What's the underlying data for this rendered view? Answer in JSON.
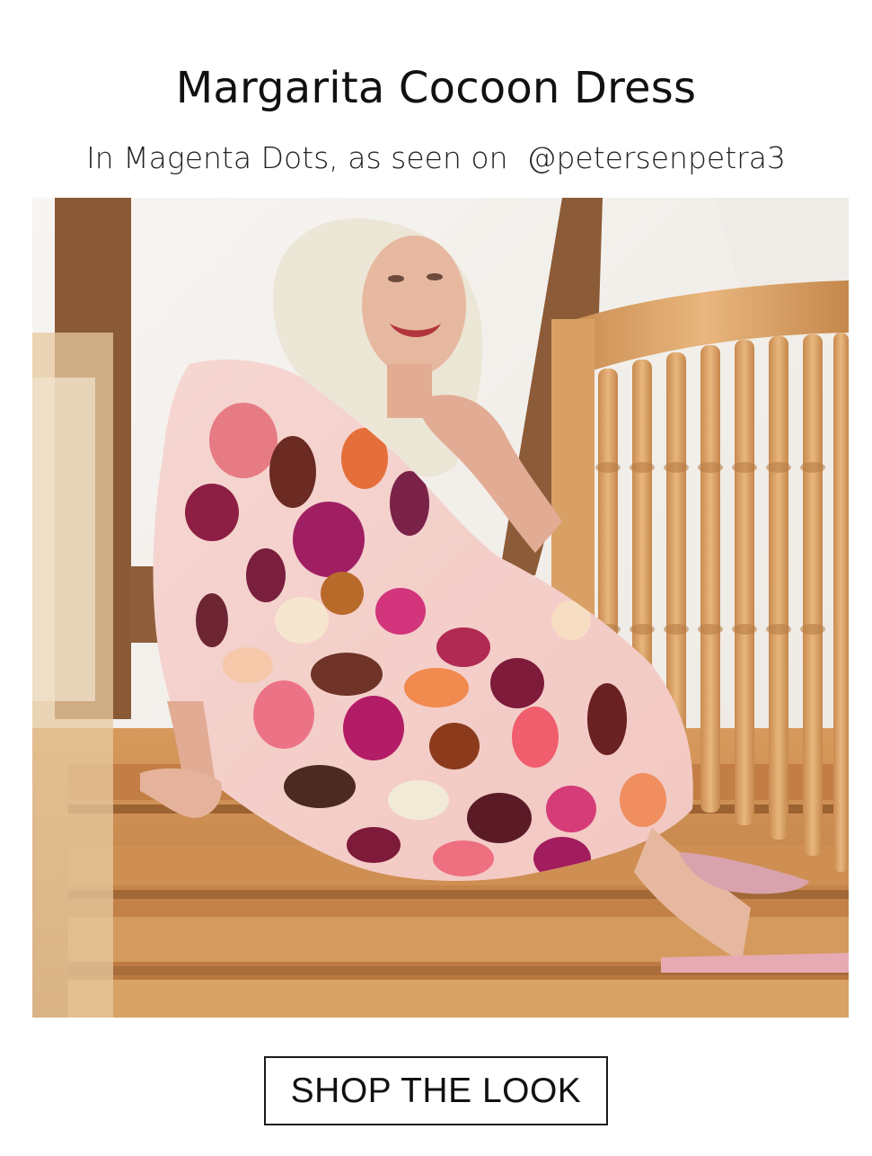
{
  "header": {
    "title": "Margarita Cocoon Dress",
    "subtitle": "In Magenta Dots, as seen on  @petersenpetra3"
  },
  "cta": {
    "label": "SHOP THE LOOK"
  },
  "colors": {
    "background": "#ffffff",
    "text": "#111111",
    "button_border": "#1a1a1a"
  }
}
